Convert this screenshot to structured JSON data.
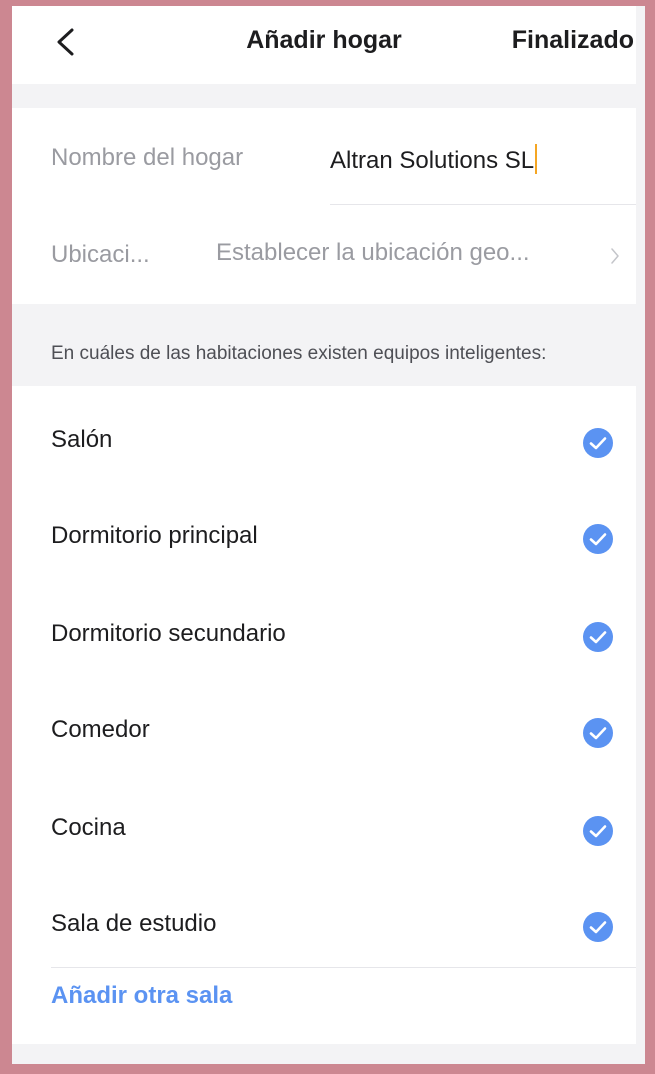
{
  "header": {
    "title": "Añadir hogar",
    "done_label": "Finalizado"
  },
  "form": {
    "name_label": "Nombre del hogar",
    "name_value": "Altran Solutions SL",
    "location_label": "Ubicaci...",
    "location_value": "Establecer la ubicación geo..."
  },
  "rooms_hint": "En cuáles de las habitaciones existen equipos inteligentes:",
  "rooms": [
    {
      "label": "Salón",
      "checked": true
    },
    {
      "label": "Dormitorio principal",
      "checked": true
    },
    {
      "label": "Dormitorio secundario",
      "checked": true
    },
    {
      "label": "Comedor",
      "checked": true
    },
    {
      "label": "Cocina",
      "checked": true
    },
    {
      "label": "Sala de estudio",
      "checked": true
    }
  ],
  "add_room_label": "Añadir otra sala",
  "colors": {
    "accent": "#5b93f2",
    "frame": "#cc8791",
    "caret": "#f5a623"
  }
}
